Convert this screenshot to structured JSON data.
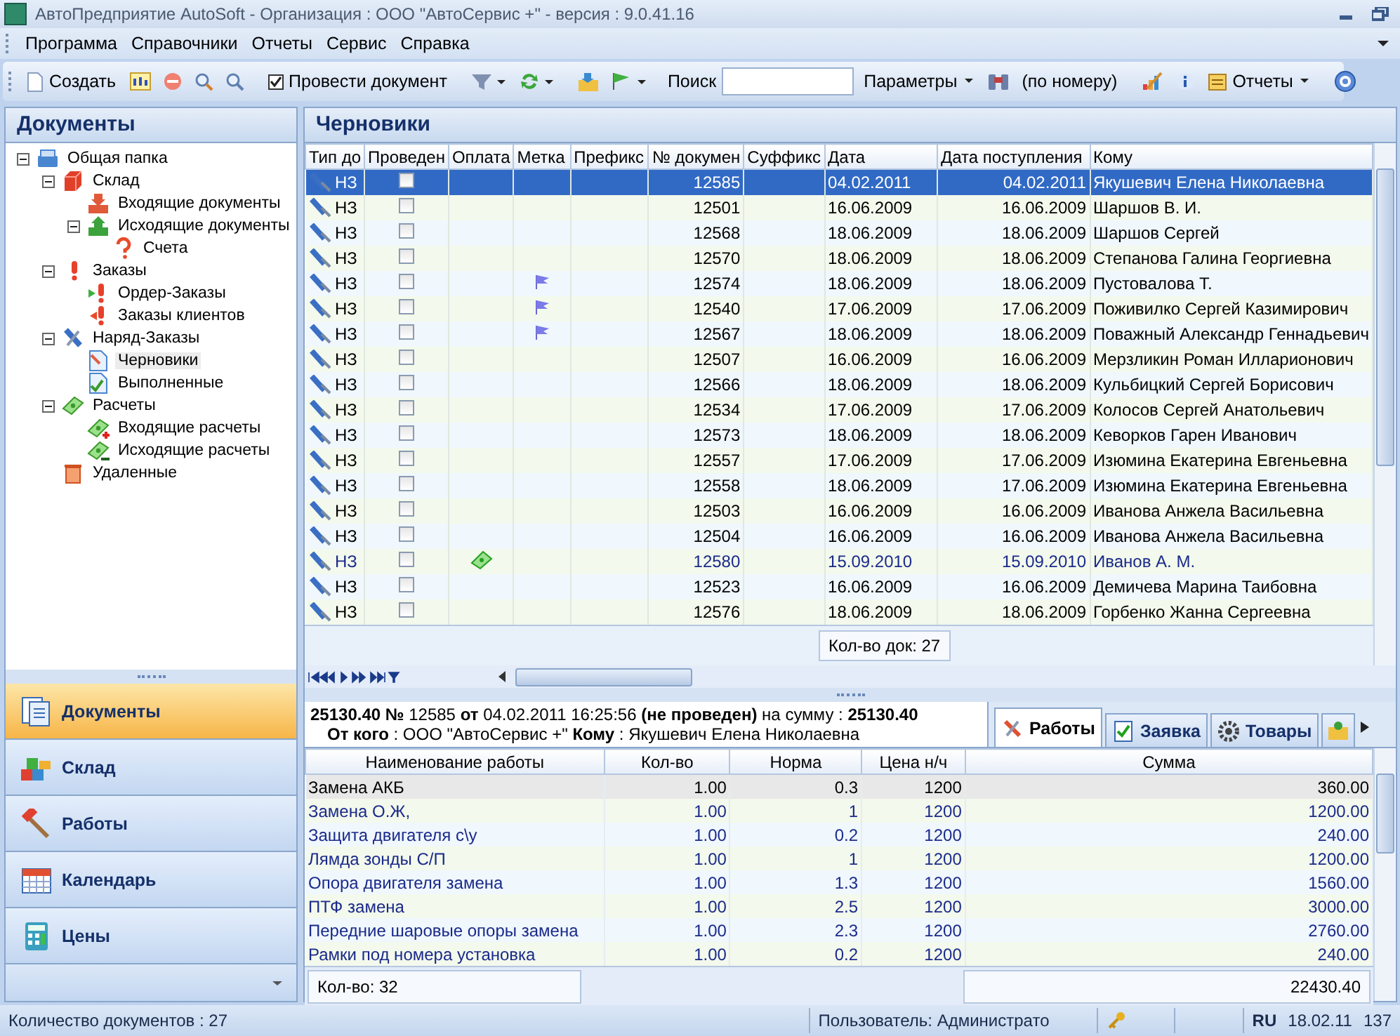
{
  "window": {
    "title": "АвтоПредприятие AutoSoft  -  Организация : ООО \"АвтоСервис +\" - версия : 9.0.41.16"
  },
  "menu": [
    "Программа",
    "Справочники",
    "Отчеты",
    "Сервис",
    "Справка"
  ],
  "toolbar": {
    "create": "Создать",
    "post_document": {
      "label": "Провести документ",
      "checked": true
    },
    "search_label": "Поиск",
    "params": "Параметры",
    "by_number": "(по номеру)",
    "reports": "Отчеты"
  },
  "sidebar": {
    "title": "Документы",
    "tree": [
      {
        "label": "Общая папка",
        "kind": "folder",
        "expanded": true,
        "selected": false,
        "children": [
          {
            "label": "Склад",
            "kind": "cube",
            "expanded": true,
            "selected": false,
            "children": [
              {
                "label": "Входящие документы",
                "kind": "tray-in",
                "selected": false
              },
              {
                "label": "Исходящие документы",
                "kind": "tray-out",
                "expanded": true,
                "selected": false,
                "children": [
                  {
                    "label": "Счета",
                    "kind": "question",
                    "selected": false
                  }
                ]
              }
            ]
          },
          {
            "label": "Заказы",
            "kind": "exclaim",
            "expanded": true,
            "selected": false,
            "children": [
              {
                "label": "Ордер-Заказы",
                "kind": "exclaim-in",
                "selected": false
              },
              {
                "label": "Заказы клиентов",
                "kind": "exclaim-out",
                "selected": false
              }
            ]
          },
          {
            "label": "Наряд-Заказы",
            "kind": "tools",
            "expanded": true,
            "selected": false,
            "children": [
              {
                "label": "Черновики",
                "kind": "draft",
                "selected": true
              },
              {
                "label": "Выполненные",
                "kind": "done",
                "selected": false
              }
            ]
          },
          {
            "label": "Расчеты",
            "kind": "money",
            "expanded": true,
            "selected": false,
            "children": [
              {
                "label": "Входящие расчеты",
                "kind": "money-in",
                "selected": false
              },
              {
                "label": "Исходящие расчеты",
                "kind": "money-out",
                "selected": false
              }
            ]
          },
          {
            "label": "Удаленные",
            "kind": "bin",
            "selected": false
          }
        ]
      }
    ]
  },
  "nav": [
    {
      "label": "Документы",
      "kind": "docs",
      "selected": true
    },
    {
      "label": "Склад",
      "kind": "cubes",
      "selected": false
    },
    {
      "label": "Работы",
      "kind": "hammer",
      "selected": false
    },
    {
      "label": "Календарь",
      "kind": "calendar",
      "selected": false
    },
    {
      "label": "Цены",
      "kind": "calculator",
      "selected": false
    }
  ],
  "grid": {
    "title": "Черновики",
    "columns": [
      "Тип до",
      "Проведен",
      "Оплата",
      "Метка",
      "Префикс",
      "№ докумен",
      "Суффикс",
      "Дата",
      "Дата поступления",
      "Кому"
    ],
    "rows": [
      {
        "type": "НЗ",
        "posted": false,
        "paid": false,
        "flagged": false,
        "number": "12585",
        "date": "04.02.2011",
        "received": "04.02.2011",
        "to": "Якушевич Елена Николаевна",
        "selected": true
      },
      {
        "type": "НЗ",
        "posted": false,
        "paid": false,
        "flagged": false,
        "number": "12501",
        "date": "16.06.2009",
        "received": "16.06.2009",
        "to": "Шаршов В. И.",
        "selected": false
      },
      {
        "type": "НЗ",
        "posted": false,
        "paid": false,
        "flagged": false,
        "number": "12568",
        "date": "18.06.2009",
        "received": "18.06.2009",
        "to": "Шаршов  Сергей",
        "selected": false
      },
      {
        "type": "НЗ",
        "posted": false,
        "paid": false,
        "flagged": false,
        "number": "12570",
        "date": "18.06.2009",
        "received": "18.06.2009",
        "to": "Степанова Галина Георгиевна",
        "selected": false
      },
      {
        "type": "НЗ",
        "posted": false,
        "paid": false,
        "flagged": true,
        "number": "12574",
        "date": "18.06.2009",
        "received": "18.06.2009",
        "to": "Пустовалова Т.",
        "selected": false
      },
      {
        "type": "НЗ",
        "posted": false,
        "paid": false,
        "flagged": true,
        "number": "12540",
        "date": "17.06.2009",
        "received": "17.06.2009",
        "to": "Поживилко Сергей Казимирович",
        "selected": false
      },
      {
        "type": "НЗ",
        "posted": false,
        "paid": false,
        "flagged": true,
        "number": "12567",
        "date": "18.06.2009",
        "received": "18.06.2009",
        "to": "Поважный Александр Геннадьевич",
        "selected": false
      },
      {
        "type": "НЗ",
        "posted": false,
        "paid": false,
        "flagged": false,
        "number": "12507",
        "date": "16.06.2009",
        "received": "16.06.2009",
        "to": "Мерзликин Роман Илларионович",
        "selected": false
      },
      {
        "type": "НЗ",
        "posted": false,
        "paid": false,
        "flagged": false,
        "number": "12566",
        "date": "18.06.2009",
        "received": "18.06.2009",
        "to": "Кульбицкий Сергей Борисович",
        "selected": false
      },
      {
        "type": "НЗ",
        "posted": false,
        "paid": false,
        "flagged": false,
        "number": "12534",
        "date": "17.06.2009",
        "received": "17.06.2009",
        "to": "Колосов Сергей Анатольевич",
        "selected": false
      },
      {
        "type": "НЗ",
        "posted": false,
        "paid": false,
        "flagged": false,
        "number": "12573",
        "date": "18.06.2009",
        "received": "18.06.2009",
        "to": "Кеворков Гарен Иванович",
        "selected": false
      },
      {
        "type": "НЗ",
        "posted": false,
        "paid": false,
        "flagged": false,
        "number": "12557",
        "date": "17.06.2009",
        "received": "17.06.2009",
        "to": "Изюмина Екатерина Евгеньевна",
        "selected": false
      },
      {
        "type": "НЗ",
        "posted": false,
        "paid": false,
        "flagged": false,
        "number": "12558",
        "date": "18.06.2009",
        "received": "17.06.2009",
        "to": "Изюмина Екатерина Евгеньевна",
        "selected": false
      },
      {
        "type": "НЗ",
        "posted": false,
        "paid": false,
        "flagged": false,
        "number": "12503",
        "date": "16.06.2009",
        "received": "16.06.2009",
        "to": "Иванова  Анжела Васильевна",
        "selected": false
      },
      {
        "type": "НЗ",
        "posted": false,
        "paid": false,
        "flagged": false,
        "number": "12504",
        "date": "16.06.2009",
        "received": "16.06.2009",
        "to": "Иванова  Анжела Васильевна",
        "selected": false
      },
      {
        "type": "НЗ",
        "posted": false,
        "paid": true,
        "flagged": false,
        "number": "12580",
        "date": "15.09.2010",
        "received": "15.09.2010",
        "to": "Иванов  А. М.",
        "selected": false
      },
      {
        "type": "НЗ",
        "posted": false,
        "paid": false,
        "flagged": false,
        "number": "12523",
        "date": "16.06.2009",
        "received": "16.06.2009",
        "to": "Демичева Марина Таибовна",
        "selected": false
      },
      {
        "type": "НЗ",
        "posted": false,
        "paid": false,
        "flagged": false,
        "number": "12576",
        "date": "18.06.2009",
        "received": "18.06.2009",
        "to": "Горбенко Жанна Сергеевна",
        "selected": false
      }
    ],
    "count": "Кол-во док: 27"
  },
  "detail": {
    "line1": "**25130.40 №**  12585  **от** 04.02.2011 16:25:56 **(не проведен)** на сумму : **25130.40**",
    "line2": "**От кого** : ООО \"АвтоСервис +\"   **Кому** : Якушевич Елена Николаевна",
    "tabs": [
      {
        "label": "Работы",
        "kind": "tools",
        "selected": true
      },
      {
        "label": "Заявка",
        "kind": "check",
        "selected": false
      },
      {
        "label": "Товары",
        "kind": "gear",
        "selected": false
      }
    ]
  },
  "works": {
    "columns": [
      "Наименование работы",
      "Кол-во",
      "Норма",
      "Цена н/ч",
      "Сумма"
    ],
    "rows": [
      {
        "name": "Замена АКБ",
        "qty": "1.00",
        "norm": "0.3",
        "price": "1200",
        "sum": "360.00",
        "selected": true
      },
      {
        "name": "Замена О.Ж,",
        "qty": "1.00",
        "norm": "1",
        "price": "1200",
        "sum": "1200.00",
        "selected": false
      },
      {
        "name": "Защита двигателя с\\у",
        "qty": "1.00",
        "norm": "0.2",
        "price": "1200",
        "sum": "240.00",
        "selected": false
      },
      {
        "name": "Лямда зонды С/П",
        "qty": "1.00",
        "norm": "1",
        "price": "1200",
        "sum": "1200.00",
        "selected": false
      },
      {
        "name": "Опора двигателя замена",
        "qty": "1.00",
        "norm": "1.3",
        "price": "1200",
        "sum": "1560.00",
        "selected": false
      },
      {
        "name": "ПТФ замена",
        "qty": "1.00",
        "norm": "2.5",
        "price": "1200",
        "sum": "3000.00",
        "selected": false
      },
      {
        "name": "Передние шаровые опоры замена",
        "qty": "1.00",
        "norm": "2.3",
        "price": "1200",
        "sum": "2760.00",
        "selected": false
      },
      {
        "name": "Рамки под номера установка",
        "qty": "1.00",
        "norm": "0.2",
        "price": "1200",
        "sum": "240.00",
        "selected": false
      }
    ],
    "count": "Кол-во: 32",
    "total": "22430.40"
  },
  "status_bar": {
    "documents": "Количество документов : 27",
    "user": "Пользователь: Администрато",
    "lang": "RU",
    "date": "18.02.11",
    "time": "137"
  }
}
